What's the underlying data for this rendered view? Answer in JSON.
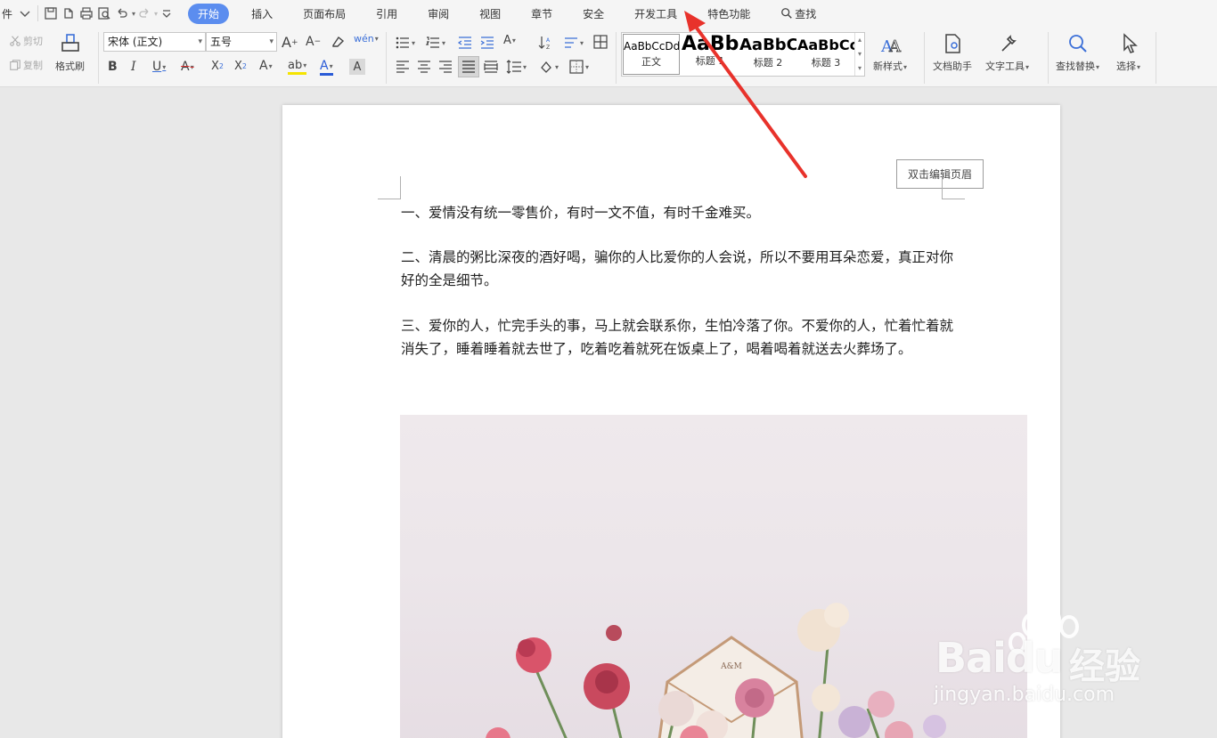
{
  "menubar": {
    "file_label": "件",
    "tabs": [
      "开始",
      "插入",
      "页面布局",
      "引用",
      "审阅",
      "视图",
      "章节",
      "安全",
      "开发工具",
      "特色功能"
    ],
    "search_label": "查找"
  },
  "ribbon": {
    "cut_label": "剪切",
    "copy_label": "复制",
    "format_painter_label": "格式刷",
    "font_name": "宋体 (正文)",
    "font_size": "五号",
    "styles": [
      {
        "preview": "AaBbCcDd",
        "name": "正文"
      },
      {
        "preview": "AaBb",
        "name": "标题 1"
      },
      {
        "preview": "AaBbC",
        "name": "标题 2"
      },
      {
        "preview": "AaBbCc",
        "name": "标题 3"
      }
    ],
    "new_style_label": "新样式",
    "doc_assistant_label": "文档助手",
    "text_tools_label": "文字工具",
    "find_replace_label": "查找替换",
    "select_label": "选择"
  },
  "document": {
    "header_tip": "双击编辑页眉",
    "paragraphs": [
      "一、爱情没有统一零售价，有时一文不值，有时千金难买。",
      "二、清晨的粥比深夜的酒好喝，骗你的人比爱你的人会说，所以不要用耳朵恋爱，真正对你好的全是细节。",
      "三、爱你的人，忙完手头的事，马上就会联系你，生怕冷落了你。不爱你的人，忙着忙着就消失了，睡着睡着就去世了，吃着吃着就死在饭桌上了，喝着喝着就送去火葬场了。"
    ],
    "envelope_text": "A&M"
  },
  "watermark": {
    "brand": "Baidu",
    "brand_cn": "经验",
    "url": "jingyan.baidu.com"
  },
  "colors": {
    "active_tab": "#5b8def",
    "arrow": "#e8322b",
    "highlight": "#f5e400",
    "font_color": "#2a5bd7",
    "strike_color": "#d33"
  }
}
